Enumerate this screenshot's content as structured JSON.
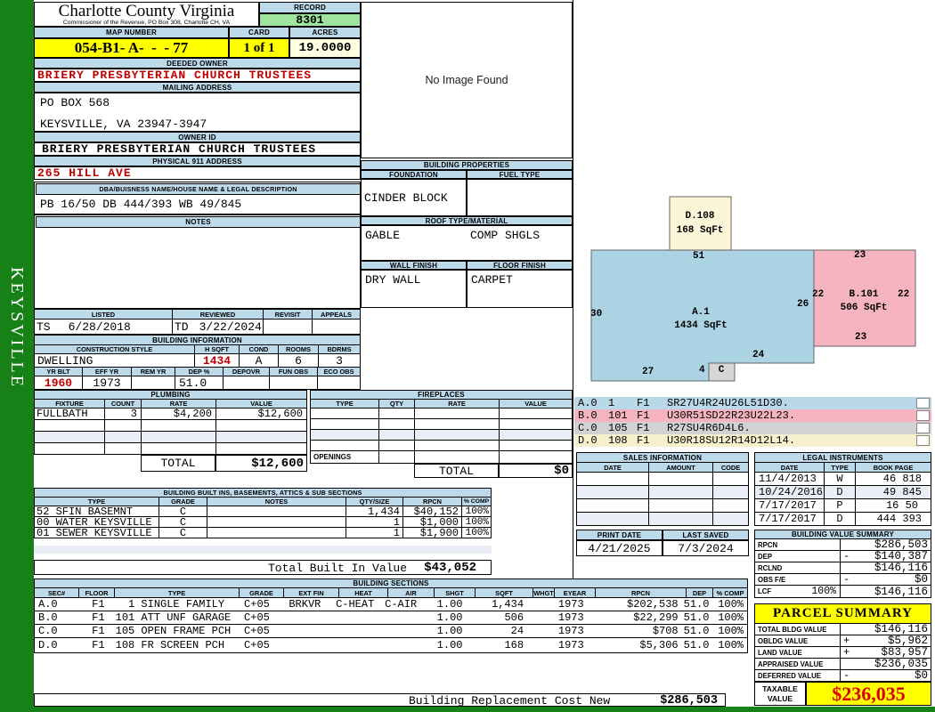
{
  "sidebar": {
    "district": "KEYSVILLE"
  },
  "header": {
    "county": "Charlotte County Virginia",
    "commissioner": "Commissioner of the Revenue, PO Box 308, Charlotte CH, VA",
    "record_label": "RECORD",
    "record": "8301",
    "map_label": "MAP NUMBER",
    "map_number": "054-B1- A-  -  - 77",
    "card_label": "CARD",
    "card": "1 of 1",
    "acres_label": "ACRES",
    "acres": "19.0000"
  },
  "owner": {
    "deeded_label": "DEEDED OWNER",
    "deeded": "BRIERY PRESBYTERIAN CHURCH TRUSTEES",
    "mailing_label": "MAILING ADDRESS",
    "mailing_line1": "PO BOX 568",
    "mailing_line2": "KEYSVILLE, VA 23947-3947",
    "owner_id_label": "OWNER ID",
    "owner_id": "BRIERY PRESBYTERIAN CHURCH TRUSTEES",
    "physical_label": "PHYSICAL 911 ADDRESS",
    "physical": "265 HILL AVE",
    "dba_label": "DBA/BUISNESS NAME/HOUSE NAME & LEGAL DESCRIPTION",
    "legal_desc": "PB 16/50 DB 444/393 WB 49/845",
    "notes_label": "NOTES"
  },
  "review": {
    "listed_label": "LISTED",
    "listed_by": "TS",
    "listed_date": "6/28/2018",
    "reviewed_label": "REVIEWED",
    "reviewed_by": "TD",
    "reviewed_date": "3/22/2024",
    "revisit_label": "REVISIT",
    "appeals_label": "APPEALS"
  },
  "building_info": {
    "title": "BUILDING INFORMATION",
    "style_label": "CONSTRUCTION STYLE",
    "style": "DWELLING",
    "hsqft_label": "H SQFT",
    "hsqft": "1434",
    "cond_label": "COND",
    "cond": "A",
    "rooms_label": "ROOMS",
    "rooms": "6",
    "bdrms_label": "BDRMS",
    "bdrms": "3",
    "yrblt_label": "YR BLT",
    "yrblt": "1960",
    "effyr_label": "EFF YR",
    "effyr": "1973",
    "remyr_label": "REM YR",
    "dep_label": "DEP %",
    "dep": "51.0",
    "depovr_label": "DEPOVR",
    "funobs_label": "FUN OBS",
    "ecoobs_label": "ECO OBS"
  },
  "plumbing": {
    "title": "PLUMBING",
    "headers": [
      "FIXTURE",
      "COUNT",
      "RATE",
      "VALUE"
    ],
    "row": {
      "fixture": "FULLBATH",
      "count": "3",
      "rate": "$4,200",
      "value": "$12,600"
    },
    "total_label": "TOTAL",
    "total": "$12,600"
  },
  "fireplaces": {
    "title": "FIREPLACES",
    "headers": [
      "TYPE",
      "QTY",
      "RATE",
      "VALUE"
    ],
    "openings_label": "OPENINGS",
    "total_label": "TOTAL",
    "total": "$0"
  },
  "built_ins": {
    "title": "BUILDING BUILT INS, BASEMENTS, ATTICS & SUB SECTIONS",
    "headers": [
      "TYPE",
      "GRADE",
      "NOTES",
      "QTY/SIZE",
      "RPCN",
      "% COMP"
    ],
    "rows": [
      {
        "type": "52 SFIN BASEMNT",
        "grade": "C",
        "qty": "1,434",
        "rpcn": "$40,152",
        "comp": "100%"
      },
      {
        "type": "00 WATER KEYSVILLE",
        "grade": "C",
        "qty": "1",
        "rpcn": "$1,000",
        "comp": "100%"
      },
      {
        "type": "01 SEWER KEYSVILLE",
        "grade": "C",
        "qty": "1",
        "rpcn": "$1,900",
        "comp": "100%"
      }
    ],
    "total_label": "Total Built In Value",
    "total": "$43,052"
  },
  "sections": {
    "title": "BUILDING SECTIONS",
    "headers": [
      "SEC#",
      "FLOOR",
      "TYPE",
      "GRADE",
      "EXT FIN",
      "HEAT",
      "AIR",
      "SHGT",
      "SQFT",
      "WHGT",
      "EYEAR",
      "RPCN",
      "DEP",
      "% COMP"
    ],
    "rows": [
      {
        "sec": "A.0",
        "floor": "F1",
        "type": "  1 SINGLE FAMILY",
        "grade": "C+05",
        "extfin": "BRKVR",
        "heat": "C-HEAT",
        "air": "C-AIR",
        "shgt": "1.00",
        "sqft": "1,434",
        "eyear": "1973",
        "rpcn": "$202,538",
        "dep": "51.0",
        "comp": "100%"
      },
      {
        "sec": "B.0",
        "floor": "F1",
        "type": "101 ATT UNF GARAGE",
        "grade": "C+05",
        "extfin": "",
        "heat": "",
        "air": "",
        "shgt": "1.00",
        "sqft": "506",
        "eyear": "1973",
        "rpcn": "$22,299",
        "dep": "51.0",
        "comp": "100%"
      },
      {
        "sec": "C.0",
        "floor": "F1",
        "type": "105 OPEN FRAME PCH",
        "grade": "C+05",
        "extfin": "",
        "heat": "",
        "air": "",
        "shgt": "1.00",
        "sqft": "24",
        "eyear": "1973",
        "rpcn": "$708",
        "dep": "51.0",
        "comp": "100%"
      },
      {
        "sec": "D.0",
        "floor": "F1",
        "type": "108 FR SCREEN PCH",
        "grade": "C+05",
        "extfin": "",
        "heat": "",
        "air": "",
        "shgt": "1.00",
        "sqft": "168",
        "eyear": "1973",
        "rpcn": "$5,306",
        "dep": "51.0",
        "comp": "100%"
      }
    ],
    "replacement_label": "Building Replacement Cost New",
    "replacement": "$286,503"
  },
  "photo": {
    "placeholder": "No Image Found"
  },
  "properties": {
    "title": "BUILDING PROPERTIES",
    "foundation_label": "FOUNDATION",
    "foundation": "CINDER BLOCK",
    "fuel_label": "FUEL TYPE",
    "roof_label": "ROOF TYPE/MATERIAL",
    "roof_type": "GABLE",
    "roof_material": "COMP SHGLS",
    "wall_label": "WALL FINISH",
    "wall": "DRY WALL",
    "floor_label": "FLOOR FINISH",
    "floor": "CARPET"
  },
  "sketch": {
    "shapes": [
      {
        "id": "A",
        "label": "A.1",
        "sqft": "1434 SqFt"
      },
      {
        "id": "B",
        "label": "B.101",
        "sqft": "506 SqFt"
      },
      {
        "id": "C",
        "label": "C"
      },
      {
        "id": "D",
        "label": "D.108",
        "sqft": "168 SqFt"
      }
    ],
    "dims": {
      "a_top": "51",
      "a_left": "30",
      "a_bottom_left": "27",
      "a_step": "4",
      "a_bottom_right": "24",
      "a_right": "26",
      "b_top": "23",
      "b_left": "22",
      "b_right": "22",
      "b_bottom": "23"
    },
    "legend": [
      {
        "sec": "A.0",
        "code": "1",
        "floor": "F1",
        "vector": "SR27U4R24U26L51D30."
      },
      {
        "sec": "B.0",
        "code": "101",
        "floor": "F1",
        "vector": "U30R51SD22R23U22L23."
      },
      {
        "sec": "C.0",
        "code": "105",
        "floor": "F1",
        "vector": "R27SU4R6D4L6."
      },
      {
        "sec": "D.0",
        "code": "108",
        "floor": "F1",
        "vector": "U30R18SU12R14D12L14."
      }
    ]
  },
  "sales": {
    "title": "SALES INFORMATION",
    "headers": [
      "DATE",
      "AMOUNT",
      "CODE"
    ]
  },
  "legal": {
    "title": "LEGAL INSTRUMENTS",
    "headers": [
      "DATE",
      "TYPE",
      "BOOK PAGE"
    ],
    "rows": [
      {
        "date": "11/4/2013",
        "type": "W",
        "book": "46 818"
      },
      {
        "date": "10/24/2016",
        "type": "D",
        "book": "49 845"
      },
      {
        "date": "7/17/2017",
        "type": "P",
        "book": "16 50"
      },
      {
        "date": "7/17/2017",
        "type": "D",
        "book": "444 393"
      }
    ]
  },
  "meta": {
    "print_label": "PRINT DATE",
    "print_date": "4/21/2025",
    "saved_label": "LAST SAVED",
    "last_saved": "7/3/2024"
  },
  "bvs": {
    "title": "BUILDING VALUE SUMMARY",
    "rows": [
      {
        "label": "RPCN",
        "sign": "",
        "value": "$286,503"
      },
      {
        "label": "DEP",
        "sign": "-",
        "value": "$140,387"
      },
      {
        "label": "RCLND",
        "sign": "",
        "value": "$146,116"
      },
      {
        "label": "OBS F/E",
        "sign": "-",
        "value": "$0"
      },
      {
        "label": "LCF",
        "pct": "100%",
        "sign": "",
        "value": "$146,116"
      }
    ]
  },
  "parcel": {
    "title": "PARCEL SUMMARY",
    "rows": [
      {
        "label": "TOTAL BLDG VALUE",
        "sign": "",
        "value": "$146,116"
      },
      {
        "label": "OBLDG VALUE",
        "sign": "+",
        "value": "$5,962"
      },
      {
        "label": "LAND VALUE",
        "sign": "+",
        "value": "$83,957"
      },
      {
        "label": "APPRAISED VALUE",
        "sign": "",
        "value": "$236,035"
      },
      {
        "label": "DEFERRED VALUE",
        "sign": "-",
        "value": "$0"
      }
    ],
    "taxable_label": "TAXABLE VALUE",
    "taxable": "$236,035"
  },
  "colors": {
    "sidebar_green": "#178117",
    "header_bar_blue": "#BCDAEA",
    "record_green": "#9FE59F",
    "highlight_yellow": "#FFFF00",
    "acres_cream": "#FFFFE1",
    "value_red": "#C00000",
    "taxable_red": "#DD0000",
    "sketch_a_blue": "#ABD3E3",
    "sketch_b_pink": "#F5B4BF",
    "sketch_c_gray": "#D6D6D6",
    "sketch_d_yellow": "#FCF6D8",
    "row_stripe": "#E9EEF6"
  }
}
